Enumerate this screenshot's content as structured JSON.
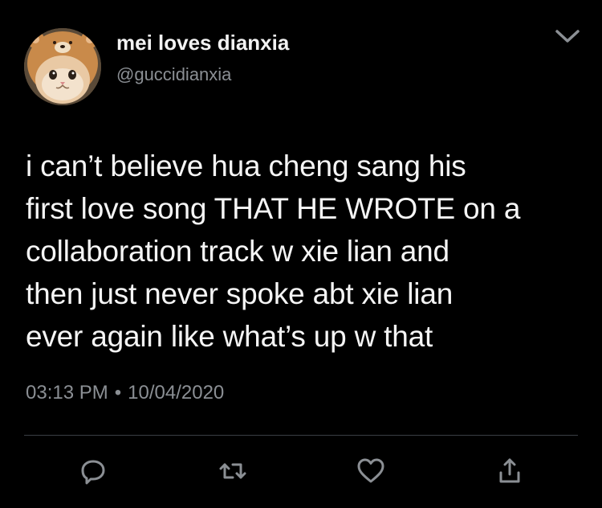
{
  "user": {
    "display_name": "mei loves dianxia",
    "handle": "@guccidianxia",
    "avatar_icon": "cat-in-bear-hat-avatar"
  },
  "tweet": {
    "text": "i can’t believe hua cheng sang his\nfirst love song THAT HE WROTE on a\ncollaboration track w xie lian and\nthen just never spoke abt xie lian\never again like what’s up w that",
    "time": "03:13 PM",
    "separator": "•",
    "date": "10/04/2020"
  },
  "actions": [
    {
      "icon": "reply-icon"
    },
    {
      "icon": "retweet-icon"
    },
    {
      "icon": "like-icon"
    },
    {
      "icon": "share-icon"
    }
  ],
  "colors": {
    "background": "#000000",
    "primary_text": "#f5f5f5",
    "secondary_text": "#8b8f94",
    "divider": "#3b3f44"
  }
}
